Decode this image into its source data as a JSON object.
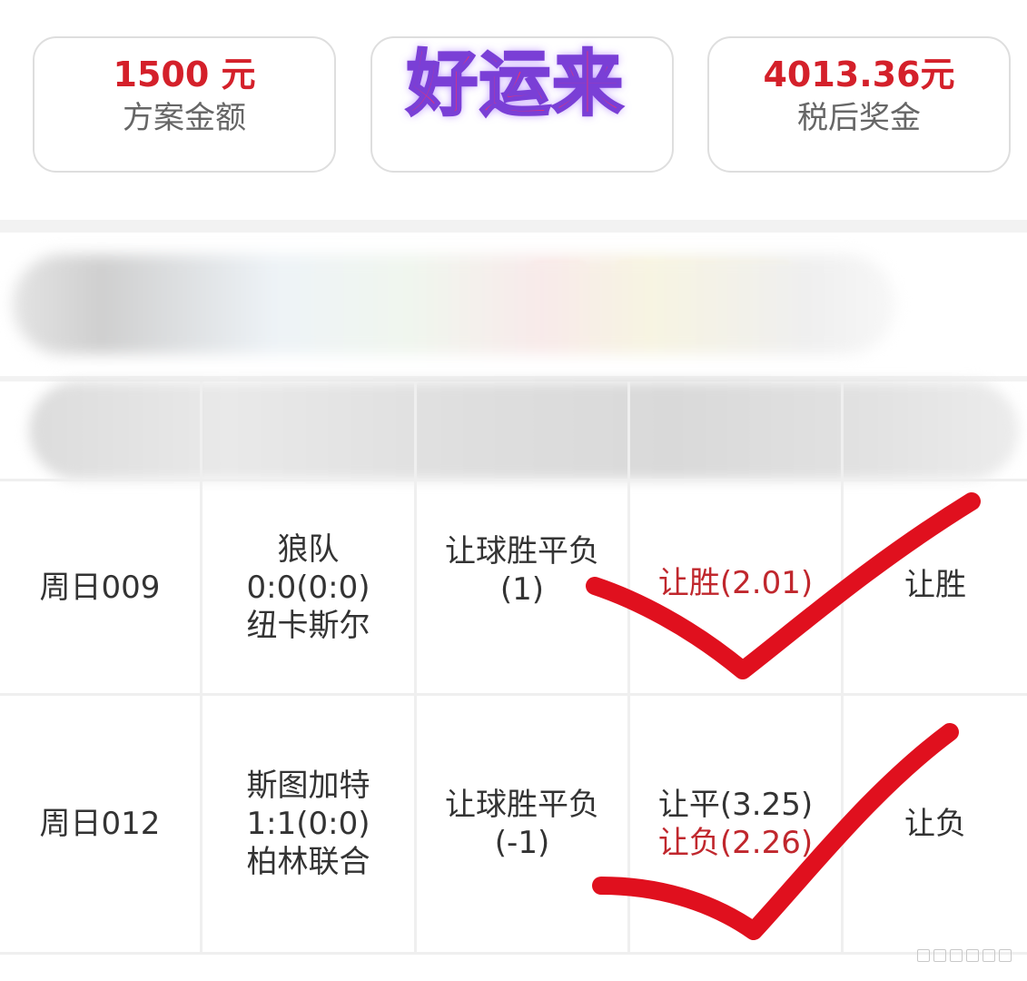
{
  "summary": {
    "plan_amount": "1500 元",
    "plan_amount_label": "方案金额",
    "after_tax_prize": "4013.36元",
    "after_tax_prize_label": "税后奖金"
  },
  "stamp_text": "好运来",
  "rows": [
    {
      "match_id": "周日009",
      "home": "狼队",
      "score": "0:0(0:0)",
      "away": "纽卡斯尔",
      "play": "让球胜平负",
      "handicap": "(1)",
      "picks": [
        {
          "text": "让胜(2.01)",
          "hit": true
        }
      ],
      "result": "让胜"
    },
    {
      "match_id": "周日012",
      "home": "斯图加特",
      "score": "1:1(0:0)",
      "away": "柏林联合",
      "play": "让球胜平负",
      "handicap": "(-1)",
      "picks": [
        {
          "text": "让平(3.25)",
          "hit": false
        },
        {
          "text": "让负(2.26)",
          "hit": true
        }
      ],
      "result": "让负"
    }
  ],
  "colors": {
    "accent_red": "#d4202a",
    "hit_red": "#c0272d",
    "check_mark": "#e0101e"
  },
  "icons": {
    "check": "check-mark-icon"
  }
}
